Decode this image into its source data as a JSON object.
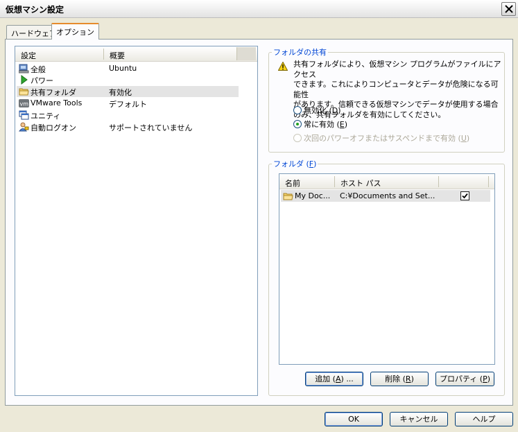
{
  "window": {
    "title": "仮想マシン設定"
  },
  "tabs": [
    {
      "label": "ハードウェア",
      "active": false
    },
    {
      "label": "オプション",
      "active": true
    }
  ],
  "settings": {
    "col_setting": "設定",
    "col_summary": "概要",
    "items": [
      {
        "name": "全般",
        "summary": "Ubuntu",
        "icon": "general-computer-icon"
      },
      {
        "name": "パワー",
        "summary": "",
        "icon": "power-play-icon"
      },
      {
        "name": "共有フォルダ",
        "summary": "有効化",
        "icon": "folder-icon",
        "selected": true
      },
      {
        "name": "VMware Tools",
        "summary": "デフォルト",
        "icon": "vmware-tools-icon"
      },
      {
        "name": "ユニティ",
        "summary": "",
        "icon": "unity-window-icon"
      },
      {
        "name": "自動ログオン",
        "summary": "サポートされていません",
        "icon": "user-logon-icon"
      }
    ]
  },
  "sharing": {
    "legend": "フォルダの共有",
    "warning_lines": [
      "共有フォルダにより、仮想マシン プログラムがファイルにアクセス",
      "できます。これによりコンピュータとデータが危険になる可能性",
      "があります。信頼できる仮想マシンでデータが使用する場合",
      "のみ、共有フォルダを有効にしてください。"
    ],
    "radios": [
      {
        "label": "無効化",
        "key": "D",
        "checked": false,
        "disabled": false
      },
      {
        "label": "常に有効",
        "key": "E",
        "checked": true,
        "disabled": false
      },
      {
        "label": "次回のパワーオフまたはサスペンドまで有効",
        "key": "U",
        "checked": false,
        "disabled": true
      }
    ]
  },
  "folders": {
    "legend": "フォルダ",
    "legend_key": "F",
    "col_name": "名前",
    "col_host": "ホスト パス",
    "rows": [
      {
        "name": "My Doc...",
        "host": "C:¥Documents and Set...",
        "enabled": true
      }
    ],
    "buttons": {
      "add": {
        "label": "追加",
        "key": "A",
        "suffix": "..."
      },
      "remove": {
        "label": "削除",
        "key": "R",
        "suffix": ""
      },
      "properties": {
        "label": "プロパティ",
        "key": "P",
        "suffix": ""
      }
    }
  },
  "dialog_buttons": {
    "ok": "OK",
    "cancel": "キャンセル",
    "help": "ヘルプ"
  },
  "colors": {
    "legend_blue": "#0046d5",
    "tab_highlight": "#e68b2c",
    "selection": "#e4e4e4"
  }
}
